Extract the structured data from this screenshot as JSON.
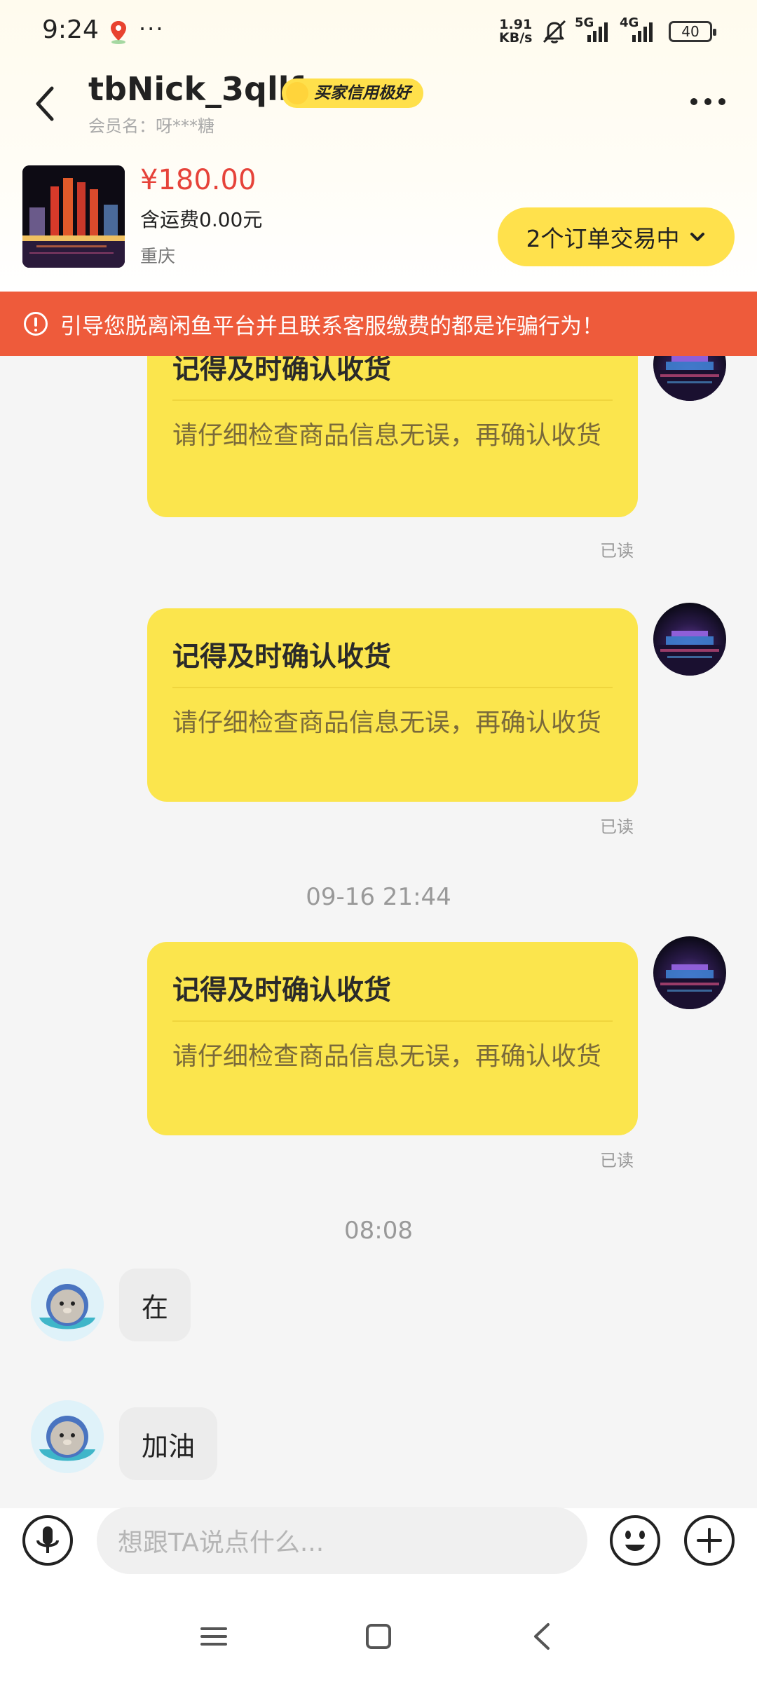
{
  "status_bar": {
    "time": "9:24",
    "dots": "···",
    "speed_value": "1.91",
    "speed_unit": "KB/s",
    "sig1": "5G",
    "sig2": "4G",
    "battery": "40"
  },
  "header": {
    "nickname": "tbNick_3qllf",
    "badge": "买家信用极好",
    "member_name": "会员名：呀***糖"
  },
  "product": {
    "price": "¥180.00",
    "shipping": "含运费0.00元",
    "location": "重庆",
    "orders_button": "2个订单交易中"
  },
  "warning": "引导您脱离闲鱼平台并且联系客服缴费的都是诈骗行为！",
  "messages": {
    "cards": [
      {
        "title": "记得及时确认收货",
        "body": "请仔细检查商品信息无误，再确认收货",
        "read": "已读"
      },
      {
        "title": "记得及时确认收货",
        "body": "请仔细检查商品信息无误，再确认收货",
        "read": "已读"
      },
      {
        "title": "记得及时确认收货",
        "body": "请仔细检查商品信息无误，再确认收货",
        "read": "已读"
      }
    ],
    "timestamp1": "09-16 21:44",
    "timestamp2": "08:08",
    "text1": "在",
    "text2": "加油"
  },
  "input": {
    "placeholder": "想跟TA说点什么..."
  },
  "colors": {
    "accent_yellow": "#ffe14c",
    "warning_red": "#ee5b3b",
    "price_red": "#e6433a"
  },
  "icons": [
    "back-arrow-icon",
    "more-icon",
    "mic-icon",
    "emoji-icon",
    "plus-icon",
    "warning-icon",
    "chevron-down-icon",
    "nav-menu-icon",
    "nav-home-icon",
    "nav-back-icon"
  ]
}
